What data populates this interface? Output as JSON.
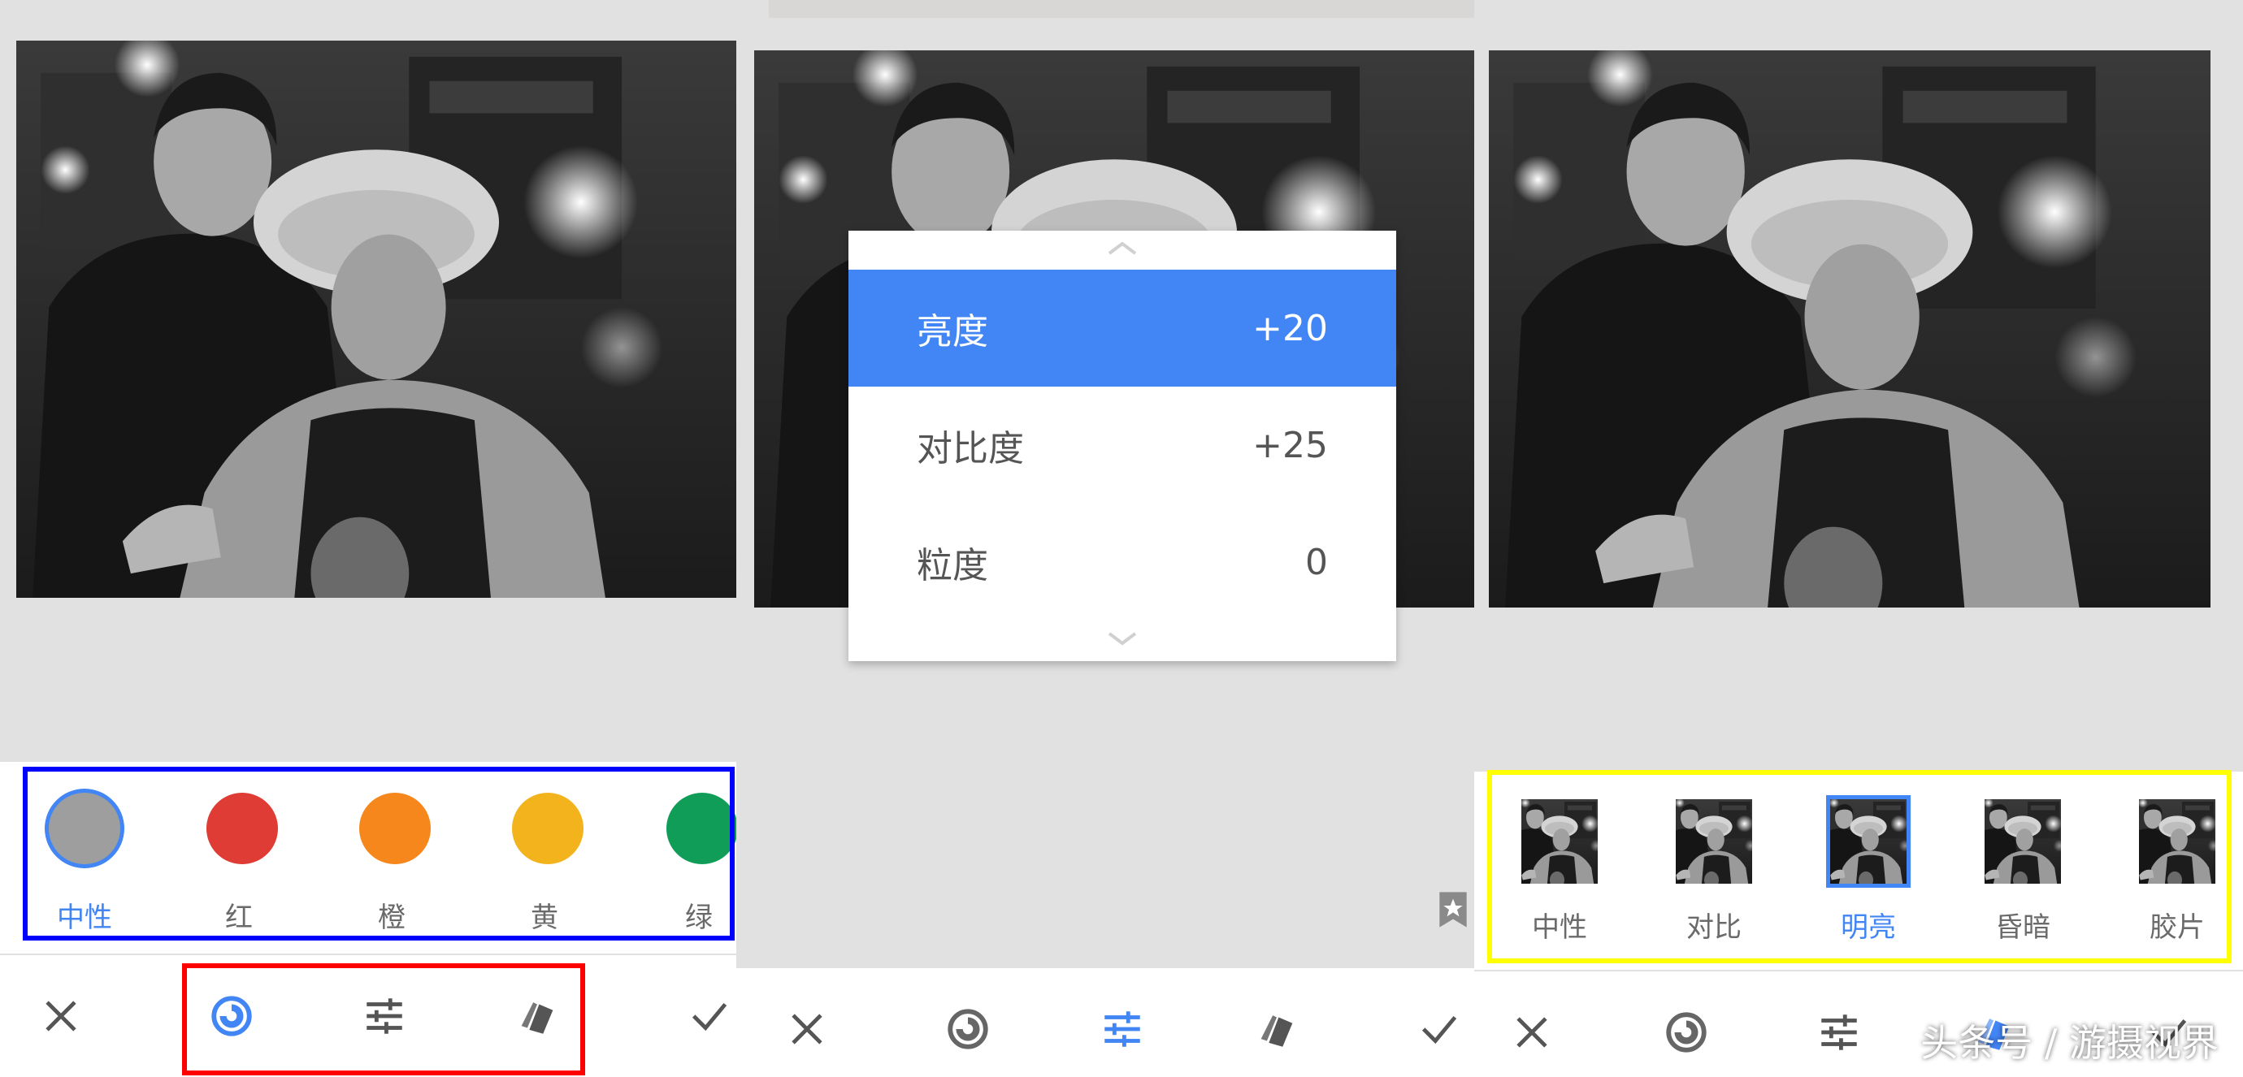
{
  "colors": {
    "accent": "#4285f4",
    "highlight_blue": "#0000ff",
    "highlight_red": "#ff0000",
    "highlight_yellow": "#ffff00"
  },
  "panel1": {
    "color_filters": [
      {
        "label": "中性",
        "color": "#9e9e9e",
        "selected": true
      },
      {
        "label": "红",
        "color": "#df3c35",
        "selected": false
      },
      {
        "label": "橙",
        "color": "#f6871c",
        "selected": false
      },
      {
        "label": "黄",
        "color": "#f3b31c",
        "selected": false
      },
      {
        "label": "绿",
        "color": "#0f9d58",
        "selected": false
      }
    ],
    "toolbar": [
      "close-icon",
      "color-filter-icon",
      "adjust-sliders-icon",
      "styles-icon",
      "check-icon"
    ]
  },
  "panel2": {
    "adjust_menu": [
      {
        "label": "亮度",
        "value": "+20",
        "active": true
      },
      {
        "label": "对比度",
        "value": "+25",
        "active": false
      },
      {
        "label": "粒度",
        "value": "0",
        "active": false
      }
    ],
    "toolbar": [
      "close-icon",
      "color-filter-icon",
      "adjust-sliders-icon",
      "styles-icon",
      "check-icon"
    ]
  },
  "panel3": {
    "presets": [
      {
        "label": "中性",
        "selected": false
      },
      {
        "label": "对比",
        "selected": false
      },
      {
        "label": "明亮",
        "selected": true
      },
      {
        "label": "昏暗",
        "selected": false
      },
      {
        "label": "胶片",
        "selected": false
      }
    ],
    "toolbar": [
      "close-icon",
      "color-filter-icon",
      "adjust-sliders-icon",
      "styles-icon",
      "check-icon"
    ]
  },
  "watermark": "头条号 / 游摄视界"
}
